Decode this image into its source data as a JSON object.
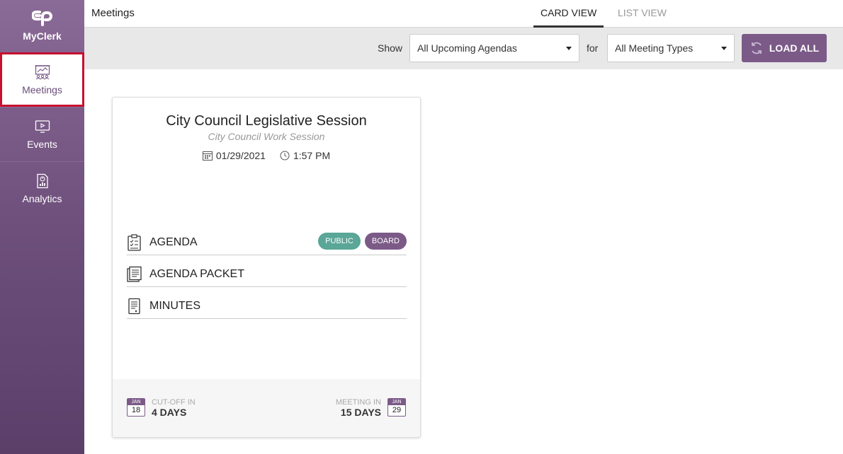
{
  "sidebar": {
    "brand": "MyClerk",
    "items": [
      {
        "label": "Meetings"
      },
      {
        "label": "Events"
      },
      {
        "label": "Analytics"
      }
    ]
  },
  "header": {
    "title": "Meetings",
    "tabs": [
      {
        "label": "CARD VIEW",
        "active": true
      },
      {
        "label": "LIST VIEW",
        "active": false
      }
    ]
  },
  "filters": {
    "show_label": "Show",
    "show_value": "All Upcoming Agendas",
    "for_label": "for",
    "for_value": "All Meeting Types",
    "load_all": "LOAD ALL"
  },
  "card": {
    "title": "City Council Legislative Session",
    "subtitle": "City Council Work Session",
    "date": "01/29/2021",
    "time": "1:57 PM",
    "documents": [
      {
        "label": "AGENDA",
        "icon": "checklist-icon"
      },
      {
        "label": "AGENDA PACKET",
        "icon": "packet-icon"
      },
      {
        "label": "MINUTES",
        "icon": "document-icon"
      }
    ],
    "badges": {
      "public": "PUBLIC",
      "board": "BOARD"
    },
    "footer": {
      "cutoff": {
        "month": "JAN",
        "day": "18",
        "label": "CUT-OFF IN",
        "value": "4 DAYS"
      },
      "meeting": {
        "month": "JAN",
        "day": "29",
        "label": "MEETING IN",
        "value": "15 DAYS"
      }
    }
  },
  "colors": {
    "brand_purple": "#7b5a88",
    "public_teal": "#5aa697",
    "highlight_red": "#c8102e"
  }
}
